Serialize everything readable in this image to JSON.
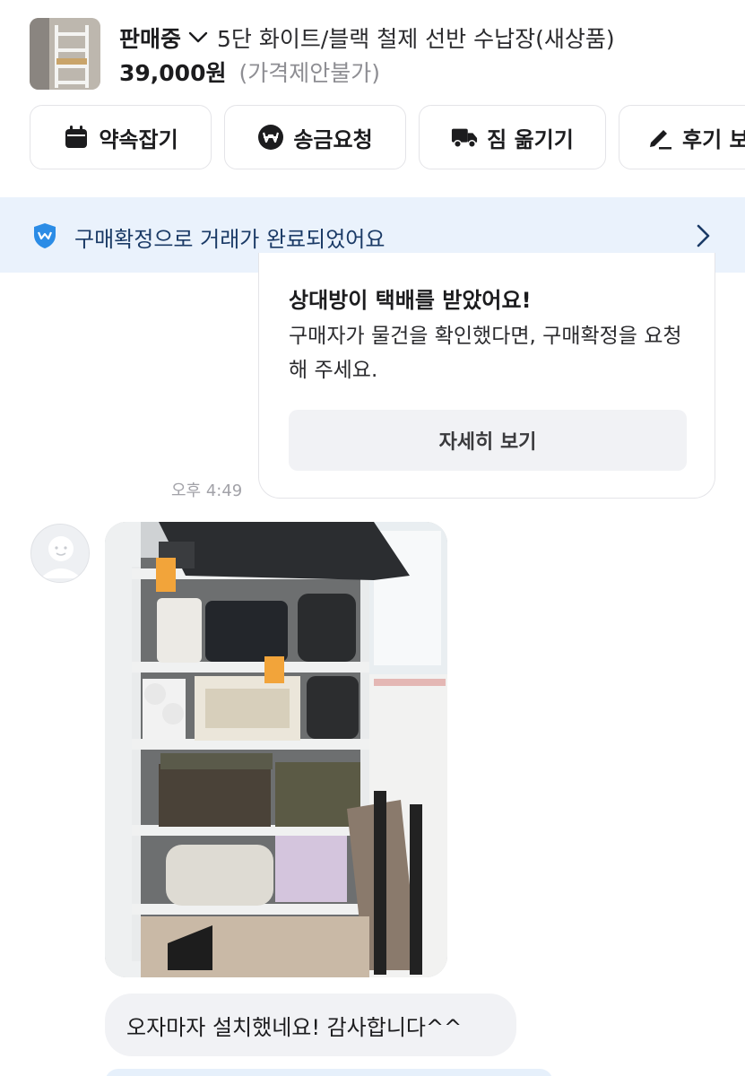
{
  "product": {
    "status": "판매중",
    "title": "5단 화이트/블랙 철제 선반 수납장(새상품)",
    "price": "39,000원",
    "price_note": "(가격제안불가)",
    "thumbnail": "white-metal-shelf-photo",
    "status_icon": "chevron-down-icon"
  },
  "actions": [
    {
      "label": "약속잡기",
      "icon": "calendar-icon"
    },
    {
      "label": "송금요청",
      "icon": "won-coin-icon"
    },
    {
      "label": "짐 옮기기",
      "icon": "truck-icon"
    },
    {
      "label": "후기 보",
      "icon": "pencil-icon"
    }
  ],
  "banner": {
    "text": "구매확정으로 거래가 완료되었어요",
    "icon": "shield-icon",
    "accent": "#2b8ce6"
  },
  "delivery_card": {
    "title": "상대방이 택배를 받았어요!",
    "description": "구매자가 물건을 확인했다면, 구매확정을 요청해 주세요.",
    "button": "자세히 보기",
    "time": "오후 4:49"
  },
  "chat": {
    "photo": "storage-shelf-installed-photo",
    "message": "오자마자 설치했네요! 감사합니다^^"
  }
}
